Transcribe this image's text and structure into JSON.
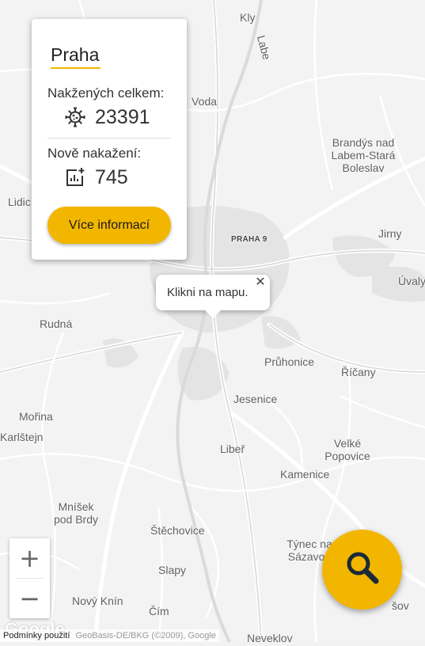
{
  "map": {
    "places": [
      {
        "id": "kly",
        "label": "Kly"
      },
      {
        "id": "labe",
        "label": "Labe"
      },
      {
        "id": "voda",
        "label": "Voda"
      },
      {
        "id": "brandys",
        "lines": [
          "Brandýs nad",
          "Labem-Stará",
          "Boleslav"
        ]
      },
      {
        "id": "lidice",
        "label": "Lidic"
      },
      {
        "id": "praha9",
        "label": "PRAHA 9"
      },
      {
        "id": "jirny",
        "label": "Jirny"
      },
      {
        "id": "uvaly",
        "label": "Úvaly"
      },
      {
        "id": "rudna",
        "label": "Rudná"
      },
      {
        "id": "pruhonice",
        "label": "Průhonice"
      },
      {
        "id": "ricany",
        "label": "Říčany"
      },
      {
        "id": "jesenice",
        "label": "Jesenice"
      },
      {
        "id": "morina",
        "label": "Mořina"
      },
      {
        "id": "karlstejn",
        "label": "Karlštejn"
      },
      {
        "id": "liber",
        "label": "Libeř"
      },
      {
        "id": "velke",
        "lines": [
          "Velké",
          "Popovice"
        ]
      },
      {
        "id": "kamenice",
        "label": "Kamenice"
      },
      {
        "id": "mnisek",
        "lines": [
          "Mníšek",
          "pod Brdy"
        ]
      },
      {
        "id": "stechovice",
        "label": "Štěchovice"
      },
      {
        "id": "tynec",
        "lines": [
          "Týnec na",
          "Sázavou"
        ]
      },
      {
        "id": "slapy",
        "label": "Slapy"
      },
      {
        "id": "novy-knin",
        "label": "Nový Knín"
      },
      {
        "id": "cim",
        "label": "Čím"
      },
      {
        "id": "benesov",
        "label": "šov"
      },
      {
        "id": "neveklov",
        "label": "Neveklov"
      }
    ]
  },
  "info_card": {
    "region": "Praha",
    "total_label": "Nakžených celkem:",
    "total_value": "23391",
    "new_label": "Nově nakažení:",
    "new_value": "745",
    "more_button": "Více informací",
    "total_icon": "virus-icon",
    "new_icon": "chart-plus-icon"
  },
  "tooltip": {
    "text": "Klikni na mapu.",
    "close": "✕"
  },
  "zoom": {
    "in": "+",
    "out": "−"
  },
  "search": {
    "icon": "search-icon"
  },
  "footer": {
    "logo": "Google",
    "terms": "Podmínky použití",
    "credits": "GeoBasis-DE/BKG (©2009), Google"
  },
  "colors": {
    "accent": "#f2b600",
    "map_bg": "#f2f2f2",
    "road": "#ffffff",
    "urban": "#e2e2e2"
  }
}
